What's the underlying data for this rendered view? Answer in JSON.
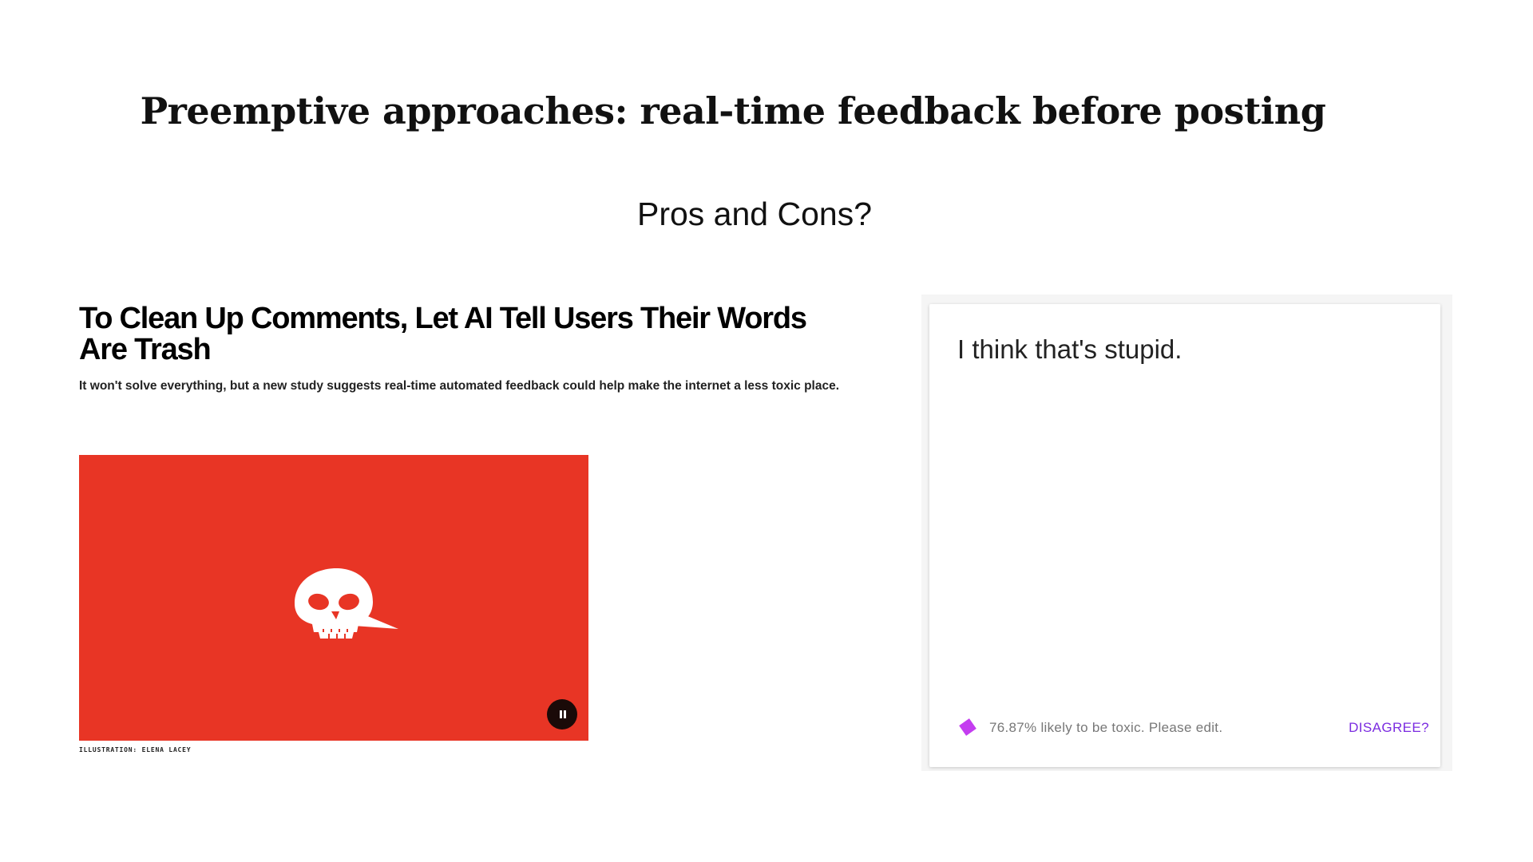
{
  "slide": {
    "title": "Preemptive approaches: real-time feedback before posting",
    "subtitle": "Pros and Cons?"
  },
  "article": {
    "headline": "To Clean Up Comments, Let AI Tell Users Their Words Are Trash",
    "dek": "It won't solve everything, but a new study suggests real-time automated feedback could help make the internet a less toxic place.",
    "image_credit": "ILLUSTRATION: ELENA LACEY",
    "image_background_color": "#e83525",
    "image_icon": "skull-speech-bubble-icon",
    "pause_icon": "pause-icon"
  },
  "feedback_card": {
    "comment": "I think that's stupid.",
    "toxicity_message": "76.87% likely to be toxic. Please edit.",
    "toxicity_score_percent": 76.87,
    "toxicity_icon": "diamond-icon",
    "toxicity_icon_color": "#c43df0",
    "disagree_label": "DISAGREE?",
    "disagree_color": "#7b2ce0"
  }
}
